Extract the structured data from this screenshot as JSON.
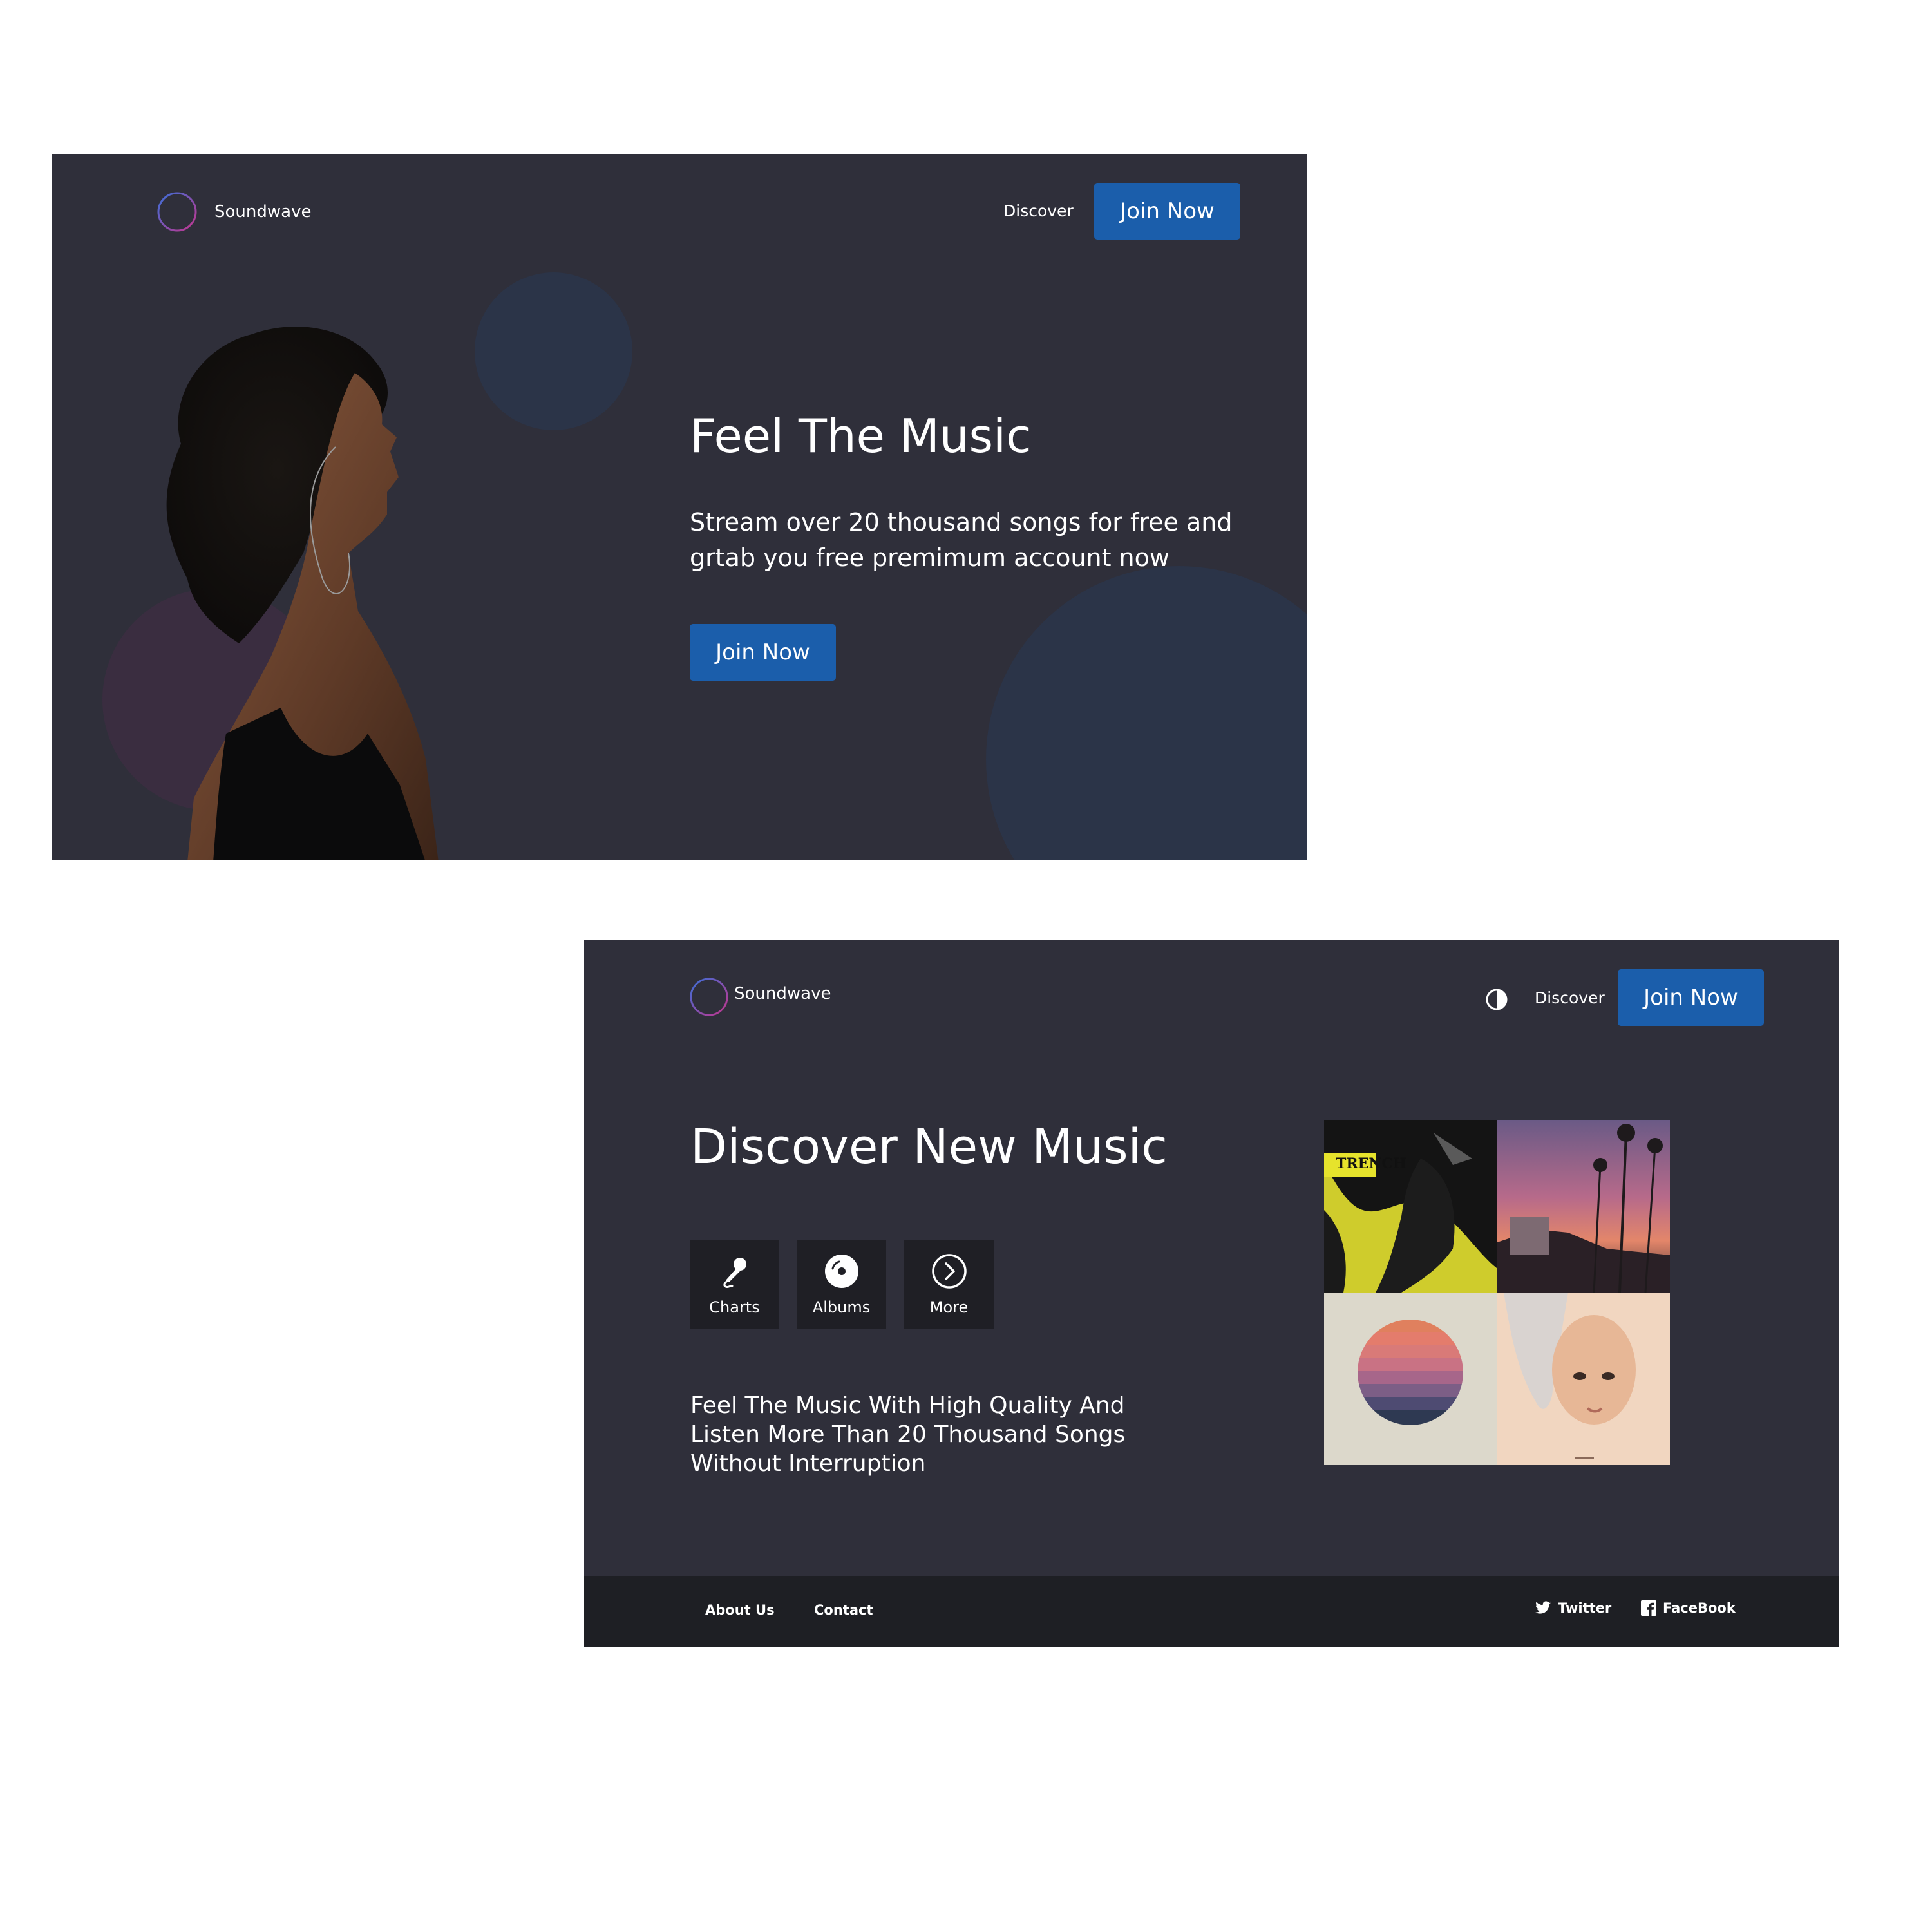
{
  "frame1": {
    "brand": {
      "name": "Soundwave"
    },
    "nav": {
      "discover": "Discover",
      "join": "Join Now"
    },
    "hero": {
      "title": "Feel The Music",
      "subtitle_line1": "Stream over 20 thousand songs for free and",
      "subtitle_line2": "grtab you free premimum account now",
      "cta": "Join Now"
    }
  },
  "frame2": {
    "brand": {
      "name": "Soundwave"
    },
    "nav": {
      "theme_toggle_icon": "contrast-icon",
      "discover": "Discover",
      "join": "Join Now"
    },
    "title": "Discover New Music",
    "tiles": [
      {
        "label": "Charts",
        "icon": "microphone-icon"
      },
      {
        "label": "Albums",
        "icon": "disc-icon"
      },
      {
        "label": "More",
        "icon": "chevron-right-circle-icon"
      }
    ],
    "description": {
      "line1": "Feel The Music With High Quality And",
      "line2": "Listen More Than 20 Thousand Songs",
      "line3": "Without Interruption"
    },
    "album_cover_text": "TRENCH",
    "footer": {
      "about": "About Us",
      "contact": "Contact",
      "twitter": "Twitter",
      "facebook": "FaceBook"
    }
  },
  "colors": {
    "background": "#2f2f3a",
    "accent": "#1b5eab",
    "footer": "#1e1f24",
    "tile": "#1f1f25",
    "blob_blue": "#2b3448",
    "blob_purple": "#3a2d40"
  }
}
